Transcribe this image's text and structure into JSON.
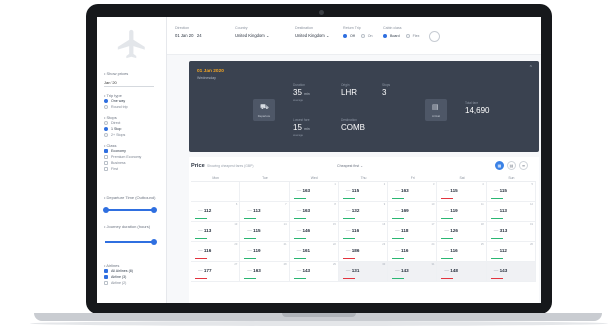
{
  "filters": [
    {
      "label": "Direction",
      "value": "01 Jan 20",
      "extra": "24"
    },
    {
      "label": "Country",
      "value": "United Kingdom ⌄"
    },
    {
      "label": "Destination",
      "value": "United Kingdom ⌄"
    },
    {
      "label": "Return Trip",
      "options": [
        {
          "label": "Off",
          "on": true
        },
        {
          "label": "On",
          "on": false
        }
      ]
    },
    {
      "label": "Cabin class",
      "options": [
        {
          "label": "Board",
          "on": true
        },
        {
          "label": "Flex",
          "on": false
        }
      ]
    }
  ],
  "sidebar": {
    "groups": [
      {
        "title": "• Show prices",
        "select": "Jan '20"
      },
      {
        "title": "• Trip type",
        "options": [
          {
            "label": "One way",
            "on": true
          },
          {
            "label": "Round trip",
            "on": false
          }
        ]
      },
      {
        "title": "• Stops",
        "options": [
          {
            "label": "Direct",
            "on": false
          },
          {
            "label": "1 Stop",
            "on": true
          },
          {
            "label": "2+ Stops",
            "on": false
          }
        ]
      },
      {
        "title": "• Class",
        "options": [
          {
            "label": "Economy",
            "on": true
          },
          {
            "label": "Premium Economy",
            "on": false
          },
          {
            "label": "Business",
            "on": false
          },
          {
            "label": "First",
            "on": false
          }
        ]
      },
      {
        "title": "• Departure Time (Outbound)"
      },
      {
        "title": "• Journey duration (hours)"
      },
      {
        "title": "• Airlines",
        "options": [
          {
            "label": "All Airlines (8)",
            "on": true
          },
          {
            "label": "Airline (3)",
            "on": true
          },
          {
            "label": "Airline (2)",
            "on": false
          }
        ]
      }
    ]
  },
  "summary": {
    "date": "01 Jan 2020",
    "subtitle": "Wednesday",
    "card_left": "Departure",
    "card_right": "Arrival",
    "stats": [
      {
        "key": "Duration",
        "value": "35",
        "unit": "min",
        "note": "average"
      },
      {
        "key": "Origin",
        "value": "LHR",
        "unit": "",
        "note": ""
      },
      {
        "key": "Stops",
        "value": "3",
        "unit": "",
        "note": ""
      },
      {
        "key": "Lowest fare",
        "value": "15",
        "unit": "min",
        "note": "average"
      },
      {
        "key": "Destination",
        "value": "COMB",
        "unit": "",
        "note": ""
      },
      {
        "key": "Total fare",
        "value": "14,690",
        "unit": "",
        "note": ""
      }
    ],
    "collapse": "⌃"
  },
  "prices": {
    "title": "Price",
    "subtitle": "Showing cheapest fares (GBP)",
    "sort": "Cheapest first ⌄",
    "days": [
      "Mon",
      "Tue",
      "Wed",
      "Thu",
      "Fri",
      "Sat",
      "Sun"
    ],
    "cells": [
      {
        "d": "",
        "p": "",
        "dim": false,
        "c": ""
      },
      {
        "d": "",
        "p": "",
        "dim": false,
        "c": ""
      },
      {
        "d": "1",
        "p": "163",
        "dim": false,
        "c": "#2bb673"
      },
      {
        "d": "2",
        "p": "115",
        "dim": false,
        "c": "#2bb673"
      },
      {
        "d": "3",
        "p": "163",
        "dim": false,
        "c": "#2bb673"
      },
      {
        "d": "4",
        "p": "115",
        "dim": false,
        "c": "#e2343f"
      },
      {
        "d": "5",
        "p": "115",
        "dim": false,
        "c": "#2bb673"
      },
      {
        "d": "6",
        "p": "112",
        "dim": false,
        "c": "#2bb673"
      },
      {
        "d": "7",
        "p": "113",
        "dim": false,
        "c": "#2bb673"
      },
      {
        "d": "8",
        "p": "163",
        "dim": false,
        "c": "#2bb673"
      },
      {
        "d": "9",
        "p": "132",
        "dim": false,
        "c": "#2bb673"
      },
      {
        "d": "10",
        "p": "169",
        "dim": false,
        "c": "#2bb673"
      },
      {
        "d": "11",
        "p": "119",
        "dim": false,
        "c": "#2bb673"
      },
      {
        "d": "12",
        "p": "113",
        "dim": false,
        "c": "#2bb673"
      },
      {
        "d": "13",
        "p": "113",
        "dim": false,
        "c": "#2bb673"
      },
      {
        "d": "14",
        "p": "115",
        "dim": false,
        "c": "#2bb673"
      },
      {
        "d": "15",
        "p": "146",
        "dim": false,
        "c": "#2bb673"
      },
      {
        "d": "16",
        "p": "116",
        "dim": false,
        "c": "#2bb673"
      },
      {
        "d": "17",
        "p": "118",
        "dim": false,
        "c": "#2bb673"
      },
      {
        "d": "18",
        "p": "126",
        "dim": false,
        "c": "#2bb673"
      },
      {
        "d": "19",
        "p": "313",
        "dim": false,
        "c": "#2bb673"
      },
      {
        "d": "20",
        "p": "116",
        "dim": false,
        "c": "#e2343f"
      },
      {
        "d": "21",
        "p": "119",
        "dim": false,
        "c": "#2bb673"
      },
      {
        "d": "22",
        "p": "161",
        "dim": false,
        "c": "#2bb673"
      },
      {
        "d": "23",
        "p": "186",
        "dim": false,
        "c": "#e2343f"
      },
      {
        "d": "24",
        "p": "116",
        "dim": false,
        "c": "#2bb673"
      },
      {
        "d": "25",
        "p": "116",
        "dim": false,
        "c": "#2bb673"
      },
      {
        "d": "26",
        "p": "112",
        "dim": false,
        "c": "#2bb673"
      },
      {
        "d": "27",
        "p": "177",
        "dim": false,
        "c": "#e2343f"
      },
      {
        "d": "28",
        "p": "163",
        "dim": false,
        "c": "#2bb673"
      },
      {
        "d": "29",
        "p": "143",
        "dim": false,
        "c": "#2bb673"
      },
      {
        "d": "30",
        "p": "131",
        "dim": true,
        "c": "#e2343f"
      },
      {
        "d": "31",
        "p": "143",
        "dim": true,
        "c": "#2bb673"
      },
      {
        "d": "",
        "p": "148",
        "dim": true,
        "c": "#e2343f"
      },
      {
        "d": "",
        "p": "143",
        "dim": true,
        "c": "#e2343f"
      }
    ]
  }
}
